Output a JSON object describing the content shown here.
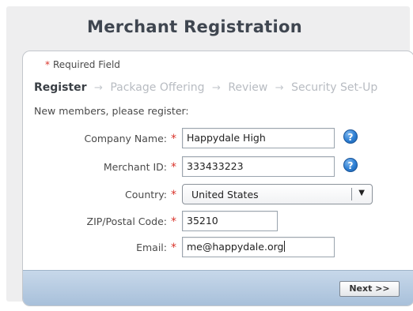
{
  "header": {
    "title": "Merchant Registration"
  },
  "form": {
    "required_note": "Required Field",
    "required_marker": "*",
    "steps": [
      {
        "label": "Register",
        "active": true
      },
      {
        "label": "Package Offering",
        "active": false
      },
      {
        "label": "Review",
        "active": false
      },
      {
        "label": "Security Set-Up",
        "active": false
      }
    ],
    "step_arrow": "→",
    "intro": "New members, please register:",
    "fields": {
      "company_name": {
        "label": "Company Name:",
        "value": "Happydale High",
        "help_icon": "question-icon"
      },
      "merchant_id": {
        "label": "Merchant ID:",
        "value": "333433223",
        "help_icon": "question-icon"
      },
      "country": {
        "label": "Country:",
        "value": "United States"
      },
      "zip": {
        "label": "ZIP/Postal Code:",
        "value": "35210"
      },
      "email": {
        "label": "Email:",
        "value": "me@happydale.org"
      }
    },
    "help_glyph": "?",
    "caret_glyph": "▼",
    "next_label": "Next >>"
  },
  "colors": {
    "required": "#d9342b",
    "accent_blue": "#2d7fd4",
    "footer": "#b6cbe2"
  }
}
